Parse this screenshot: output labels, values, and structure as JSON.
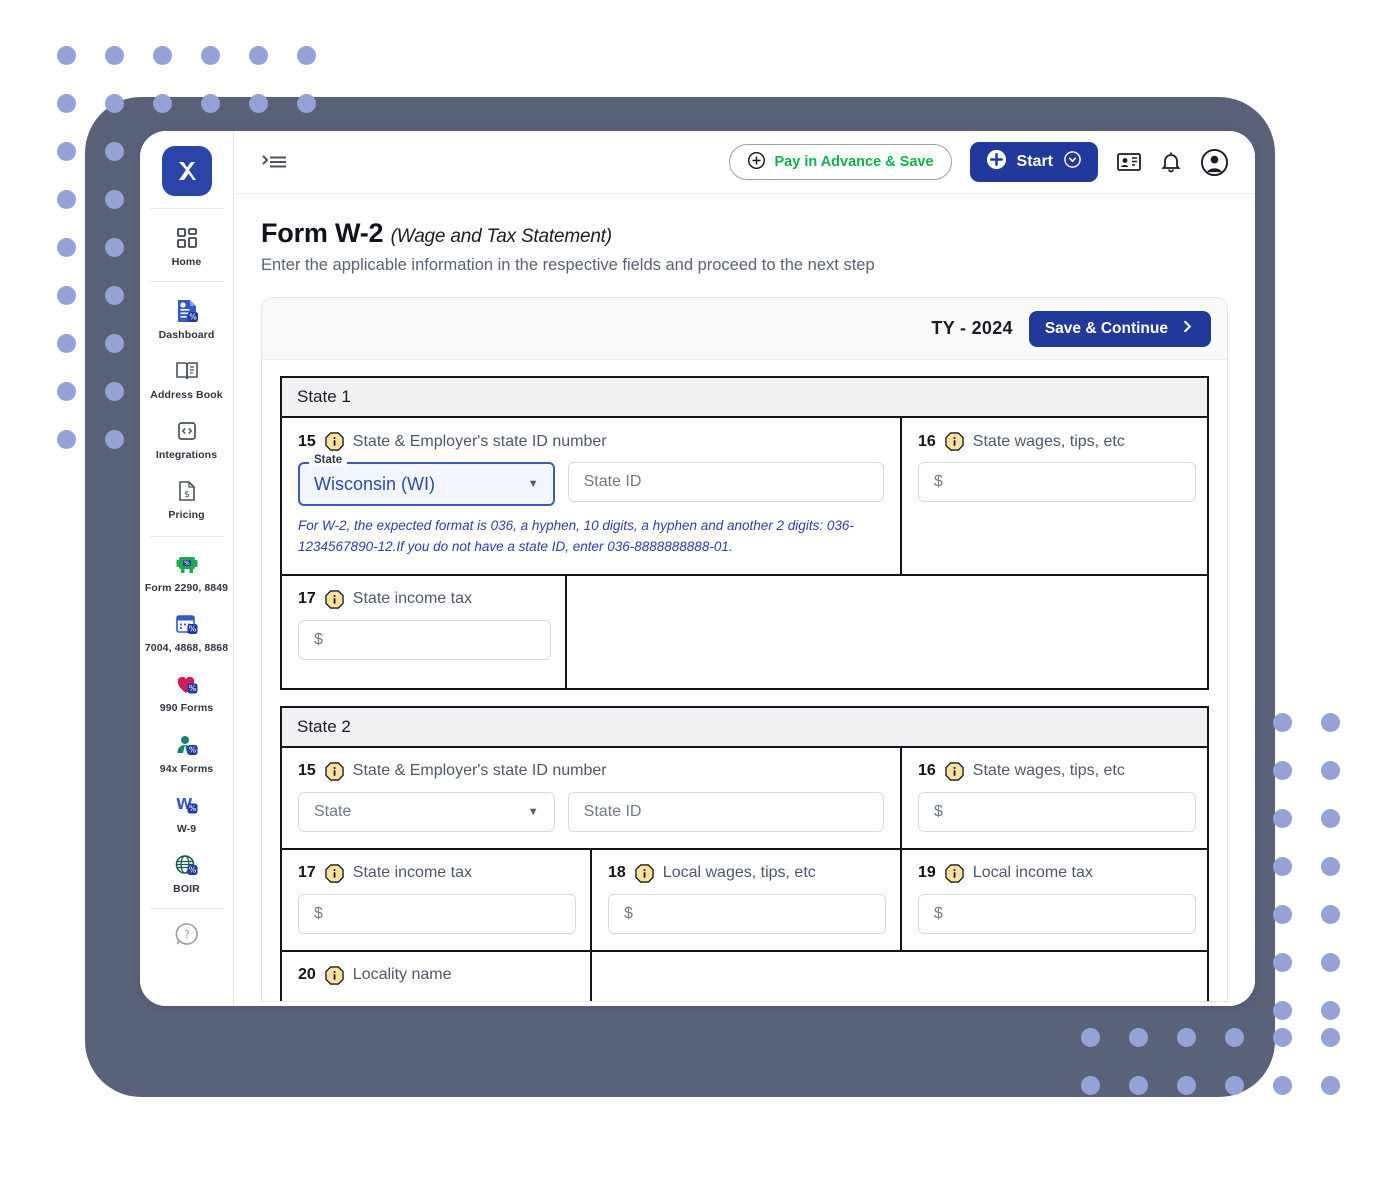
{
  "brand": {
    "logo_text": "X"
  },
  "sidebar": {
    "items": [
      {
        "label": "Home",
        "icon": "grid-icon"
      },
      {
        "label": "Dashboard",
        "icon": "dashboard-doc-icon"
      },
      {
        "label": "Address Book",
        "icon": "address-book-icon"
      },
      {
        "label": "Integrations",
        "icon": "integrations-code-icon"
      },
      {
        "label": "Pricing",
        "icon": "pricing-tag-icon"
      }
    ],
    "forms": [
      {
        "label": "Form 2290, 8849",
        "icon": "truck-icon"
      },
      {
        "label": "7004, 4868, 8868",
        "icon": "calendar-icon"
      },
      {
        "label": "990 Forms",
        "icon": "heart-icon"
      },
      {
        "label": "94x Forms",
        "icon": "person-icon"
      },
      {
        "label": "W-9",
        "icon": "w9-icon"
      },
      {
        "label": "BOIR",
        "icon": "globe-icon"
      }
    ],
    "help": {
      "label": "",
      "icon": "help-question-icon"
    }
  },
  "topbar": {
    "menu_toggle_icon": "menu-collapse-icon",
    "pay_button": {
      "label": "Pay in Advance & Save",
      "icon": "plus-circle-icon"
    },
    "start_button": {
      "label": "Start",
      "icon": "plus-circle-filled-icon",
      "caret_icon": "chevron-down-circle-icon"
    },
    "contact_icon": "contact-card-icon",
    "bell_icon": "notification-bell-icon",
    "account_icon": "user-account-icon"
  },
  "page": {
    "title": "Form W-2",
    "title_sub": "(Wage and Tax Statement)",
    "description": "Enter the applicable information in the respective fields and proceed to the next step"
  },
  "card": {
    "tax_year": "TY - 2024",
    "save_continue": "Save & Continue",
    "save_continue_icon": "chevron-right-icon"
  },
  "state1": {
    "heading": "State 1",
    "f15": {
      "number": "15",
      "label": "State & Employer's state ID number",
      "select_legend": "State",
      "select_value": "Wisconsin (WI)",
      "stateid_placeholder": "State ID",
      "hint": "For W-2, the expected format is 036, a hyphen, 10 digits, a hyphen and another 2 digits: 036-1234567890-12.If you do not have a state ID, enter 036-8888888888-01."
    },
    "f16": {
      "number": "16",
      "label": "State wages, tips, etc",
      "placeholder": "$"
    },
    "f17": {
      "number": "17",
      "label": "State income tax",
      "placeholder": "$"
    }
  },
  "state2": {
    "heading": "State 2",
    "f15": {
      "number": "15",
      "label": "State & Employer's state ID number",
      "select_placeholder": "State",
      "stateid_placeholder": "State ID"
    },
    "f16": {
      "number": "16",
      "label": "State wages, tips, etc",
      "placeholder": "$"
    },
    "f17": {
      "number": "17",
      "label": "State income tax",
      "placeholder": "$"
    },
    "f18": {
      "number": "18",
      "label": "Local wages, tips, etc",
      "placeholder": "$"
    },
    "f19": {
      "number": "19",
      "label": "Local income tax",
      "placeholder": "$"
    },
    "f20": {
      "number": "20",
      "label": "Locality name"
    }
  },
  "colors": {
    "brand_blue": "#22399c",
    "accent_green": "#14b04b",
    "frame_slate": "#5a6279",
    "dot_lavender": "#94a2d6",
    "info_amber": "#fbe0a0",
    "hint_blue": "#2d3fa8"
  }
}
